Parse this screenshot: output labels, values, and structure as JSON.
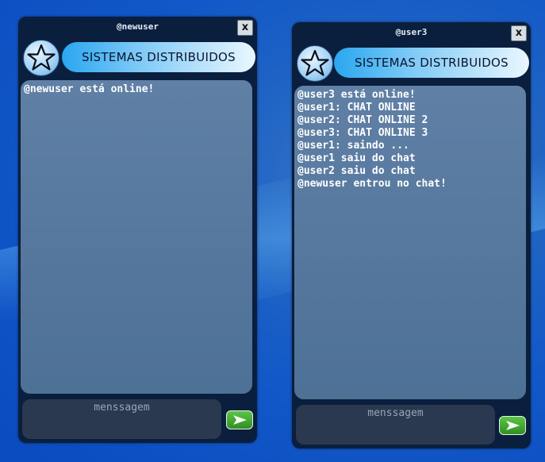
{
  "windows": [
    {
      "title": "@newuser",
      "banner": "SISTEMAS DISTRIBUIDOS",
      "close_label": "x",
      "messages": [
        "@newuser está online!"
      ],
      "input_placeholder": "menssagem"
    },
    {
      "title": "@user3",
      "banner": "SISTEMAS DISTRIBUIDOS",
      "close_label": "x",
      "messages": [
        "@user3 está online!",
        "@user1: CHAT ONLINE",
        "@user2: CHAT ONLINE 2",
        "@user3: CHAT ONLINE 3",
        "@user1: saindo ...",
        "@user1 saiu do chat",
        "@user2 saiu do chat",
        "@newuser entrou no chat!"
      ],
      "input_placeholder": "menssagem"
    }
  ],
  "icons": {
    "badge": "star-icon",
    "send": "send-arrow-icon",
    "close": "close-icon"
  },
  "colors": {
    "window_bg": "#0a1f3d",
    "send_green": "#3a9e2c",
    "banner_blue": "#2aa6f0"
  }
}
